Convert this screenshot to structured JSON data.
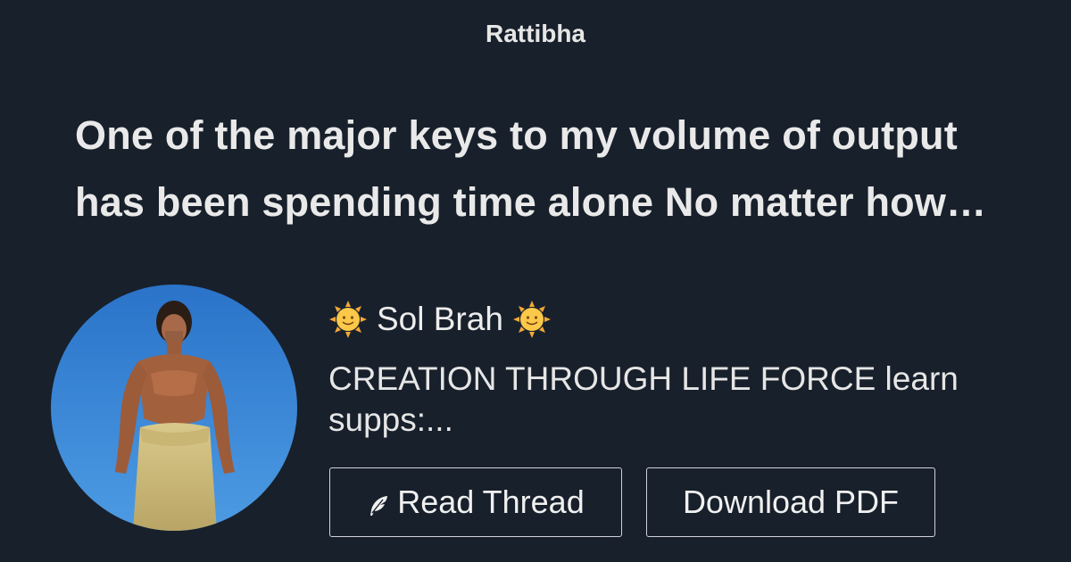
{
  "site": {
    "name": "Rattibha"
  },
  "thread": {
    "title_line1": "One of the major keys to my volume of output",
    "title_line2": "has been spending time alone No matter how…"
  },
  "author": {
    "name": "Sol Brah",
    "prefix_icon": "sun-face-emoji",
    "suffix_icon": "sun-face-emoji",
    "bio_line1": "CREATION THROUGH LIFE FORCE learn",
    "bio_line2": "supps:..."
  },
  "actions": {
    "read_label": "Read Thread",
    "read_icon": "feather-icon",
    "download_label": "Download PDF"
  },
  "colors": {
    "background": "#18202b",
    "text": "#e8e8e8",
    "button_border": "#cfd3d8",
    "sky": "#2e7fd3"
  }
}
